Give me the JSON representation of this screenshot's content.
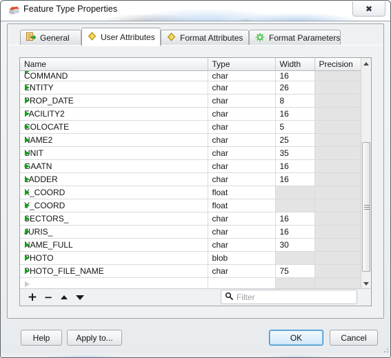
{
  "window": {
    "title": "Feature Type Properties",
    "icon": "app-icon",
    "close_label": "✕"
  },
  "tabs": [
    {
      "label": "General",
      "icon": "general-icon",
      "active": false
    },
    {
      "label": "User Attributes",
      "icon": "yellow-diamond-icon",
      "active": true
    },
    {
      "label": "Format Attributes",
      "icon": "yellow-diamond-icon",
      "active": false
    },
    {
      "label": "Format Parameters",
      "icon": "green-gear-icon",
      "active": false
    }
  ],
  "table": {
    "columns": [
      "Name",
      "Type",
      "Width",
      "Precision"
    ],
    "rows": [
      {
        "name": "COMMAND",
        "type": "char",
        "width": "16",
        "precision": "",
        "clipped": true
      },
      {
        "name": "ENTITY",
        "type": "char",
        "width": "26",
        "precision": ""
      },
      {
        "name": "PROP_DATE",
        "type": "char",
        "width": "8",
        "precision": ""
      },
      {
        "name": "FACILITY2",
        "type": "char",
        "width": "16",
        "precision": ""
      },
      {
        "name": "COLOCATE",
        "type": "char",
        "width": "5",
        "precision": ""
      },
      {
        "name": "NAME2",
        "type": "char",
        "width": "25",
        "precision": ""
      },
      {
        "name": "UNIT",
        "type": "char",
        "width": "35",
        "precision": ""
      },
      {
        "name": "GAATN",
        "type": "char",
        "width": "16",
        "precision": ""
      },
      {
        "name": "LADDER",
        "type": "char",
        "width": "16",
        "precision": ""
      },
      {
        "name": "X_COORD",
        "type": "float",
        "width": "",
        "precision": "",
        "width_disabled": true
      },
      {
        "name": "Y_COORD",
        "type": "float",
        "width": "",
        "precision": "",
        "width_disabled": true
      },
      {
        "name": "SECTORS_",
        "type": "char",
        "width": "16",
        "precision": ""
      },
      {
        "name": "JURIS_",
        "type": "char",
        "width": "16",
        "precision": ""
      },
      {
        "name": "NAME_FULL",
        "type": "char",
        "width": "30",
        "precision": ""
      },
      {
        "name": "PHOTO",
        "type": "blob",
        "width": "",
        "precision": "",
        "width_disabled": true
      },
      {
        "name": "PHOTO_FILE_NAME",
        "type": "char",
        "width": "75",
        "precision": ""
      },
      {
        "name": "",
        "type": "",
        "width": "",
        "precision": "",
        "placeholder": true
      }
    ]
  },
  "toolbar": {
    "add_label": "+",
    "delete_label": "−",
    "move_up_label": "move-up",
    "move_down_label": "move-down"
  },
  "filter": {
    "value": "",
    "placeholder": "Filter",
    "icon": "search-icon"
  },
  "buttons": {
    "help": "Help",
    "apply_to": "Apply to...",
    "ok": "OK",
    "cancel": "Cancel"
  },
  "colors": {
    "row_arrow_green": "#13a01a",
    "tab_diamond_yellow": "#e8c528",
    "gear_green": "#2fbf2f",
    "ok_focus_blue": "#2f87c9",
    "disabled_cell": "#e4e4e4"
  }
}
